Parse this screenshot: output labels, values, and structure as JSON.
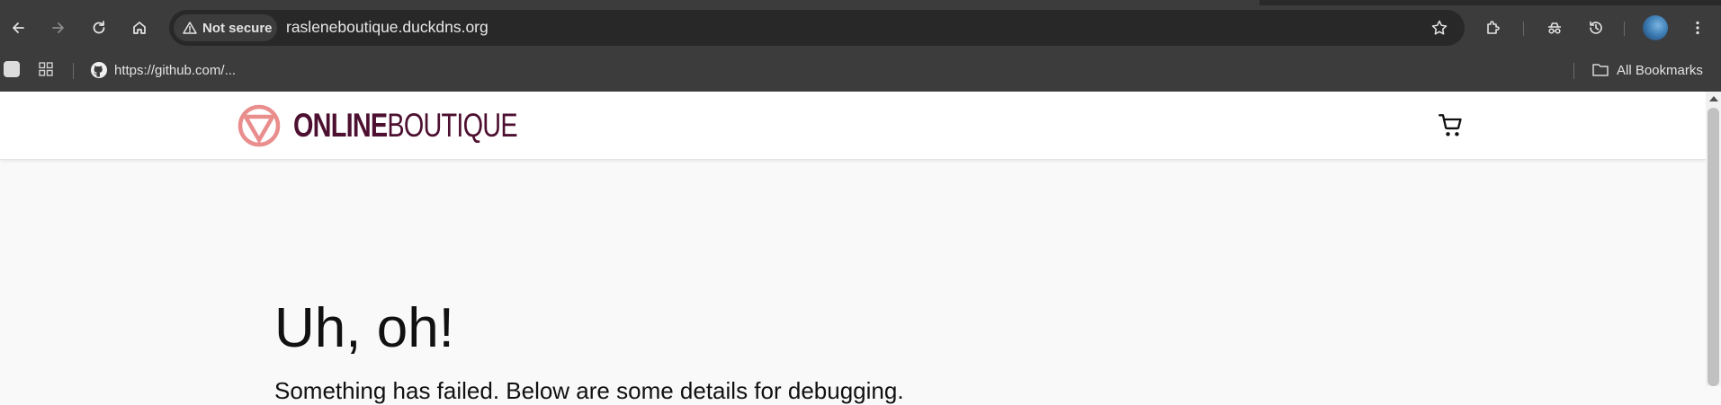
{
  "browser": {
    "security_chip": "Not secure",
    "url": "rasleneboutique.duckdns.org",
    "icons": [
      "back-icon",
      "forward-icon",
      "reload-icon",
      "home-icon",
      "warning-icon",
      "star-icon",
      "extensions-icon",
      "incognito-icon",
      "history-icon",
      "avatar",
      "menu-icon"
    ],
    "bookmarks_bar": {
      "items": [
        {
          "label": "https://github.com/..."
        }
      ],
      "all_bookmarks": "All Bookmarks"
    }
  },
  "site": {
    "logo": {
      "bold": "ONLINE",
      "light": "BOUTIQUE"
    },
    "brand_colors": {
      "logo_mark": "#e98d8d",
      "logo_text": "#4d1030"
    }
  },
  "main": {
    "heading": "Uh, oh!",
    "message": "Something has failed. Below are some details for debugging."
  }
}
